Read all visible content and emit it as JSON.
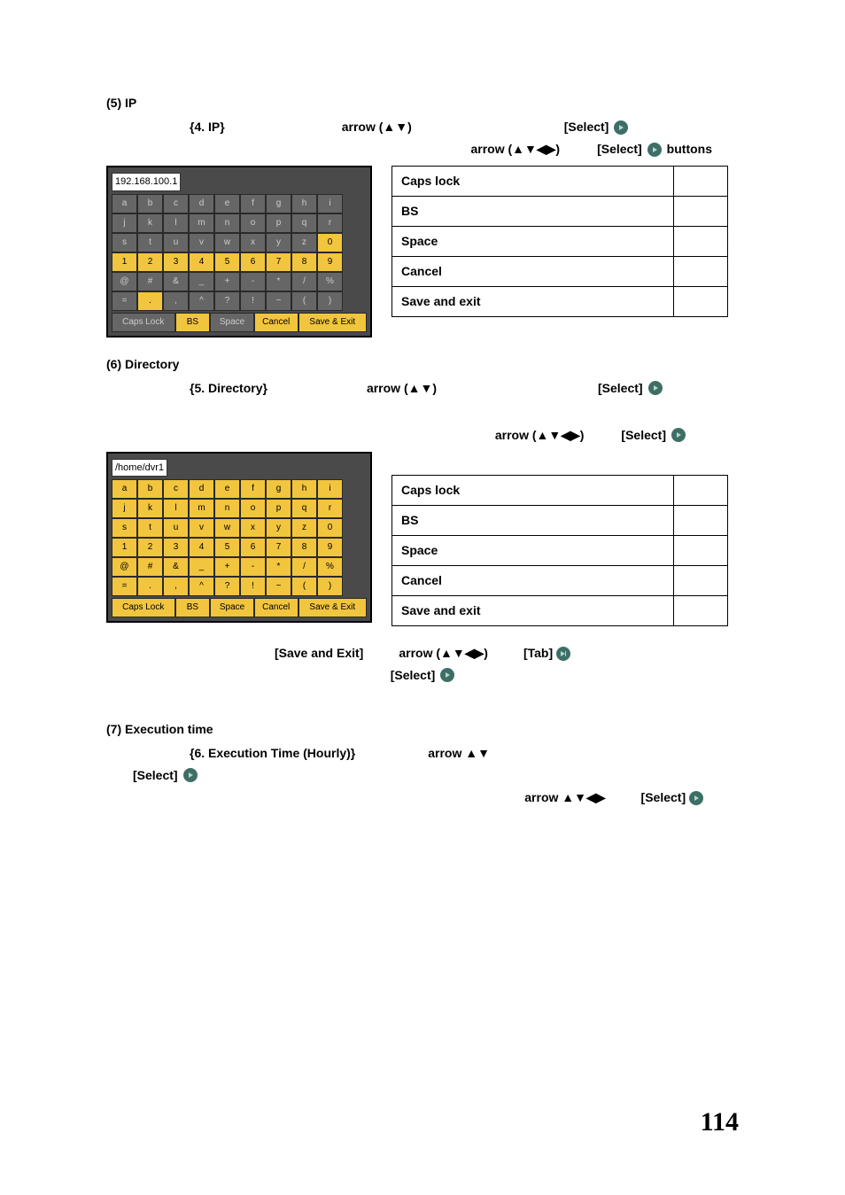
{
  "section5": {
    "heading": "(5) IP",
    "line1_a": "{4. IP}",
    "line1_b": "arrow (▲▼)",
    "line1_c": "[Select]",
    "line2_a": "arrow (▲▼◀▶)",
    "line2_b": "[Select]",
    "line2_c": "buttons",
    "keyboard": {
      "field": "192.168.100.1",
      "rows": [
        [
          "a",
          "b",
          "c",
          "d",
          "e",
          "f",
          "g",
          "h",
          "i"
        ],
        [
          "j",
          "k",
          "l",
          "m",
          "n",
          "o",
          "p",
          "q",
          "r"
        ],
        [
          "s",
          "t",
          "u",
          "v",
          "w",
          "x",
          "y",
          "z",
          "0"
        ],
        [
          "1",
          "2",
          "3",
          "4",
          "5",
          "6",
          "7",
          "8",
          "9"
        ],
        [
          "@",
          "#",
          "&",
          "_",
          "+",
          "-",
          "*",
          "/",
          "%"
        ],
        [
          "=",
          ".",
          ",",
          "^",
          "?",
          "!",
          "~",
          "(",
          ")"
        ]
      ],
      "hot": "0",
      "digitsHot": true,
      "fn": [
        "Caps Lock",
        "BS",
        "Space",
        "Cancel",
        "Save & Exit"
      ],
      "fnHot": [
        "BS",
        "Cancel",
        "Save & Exit"
      ]
    },
    "table": [
      "Caps lock",
      "BS",
      "Space",
      "Cancel",
      "Save and exit"
    ]
  },
  "section6": {
    "heading": "(6) Directory",
    "line1_a": "{5. Directory}",
    "line1_b": "arrow (▲▼)",
    "line1_c": "[Select]",
    "line2_a": "arrow (▲▼◀▶)",
    "line2_b": "[Select]",
    "keyboard": {
      "field": "/home/dvr1",
      "rows": [
        [
          "a",
          "b",
          "c",
          "d",
          "e",
          "f",
          "g",
          "h",
          "i"
        ],
        [
          "j",
          "k",
          "l",
          "m",
          "n",
          "o",
          "p",
          "q",
          "r"
        ],
        [
          "s",
          "t",
          "u",
          "v",
          "w",
          "x",
          "y",
          "z",
          "0"
        ],
        [
          "1",
          "2",
          "3",
          "4",
          "5",
          "6",
          "7",
          "8",
          "9"
        ],
        [
          "@",
          "#",
          "&",
          "_",
          "+",
          "-",
          "*",
          "/",
          "%"
        ],
        [
          "=",
          ".",
          ",",
          "^",
          "?",
          "!",
          "~",
          "(",
          ")"
        ]
      ],
      "hotRow0": true,
      "fn": [
        "Caps Lock",
        "BS",
        "Space",
        "Cancel",
        "Save & Exit"
      ]
    },
    "table": [
      "Caps lock",
      "BS",
      "Space",
      "Cancel",
      "Save and exit"
    ],
    "bottom_a": "[Save and Exit]",
    "bottom_b": "arrow (▲▼◀▶)",
    "bottom_c": "[Tab]",
    "bottom_d": "[Select]"
  },
  "section7": {
    "heading": "(7) Execution time",
    "line1_a": "{6. Execution Time (Hourly)}",
    "line1_b": "arrow ▲▼",
    "line2_a": "[Select]",
    "line3_a": "arrow ▲▼◀▶",
    "line3_b": "[Select]"
  },
  "pageNumber": "114"
}
